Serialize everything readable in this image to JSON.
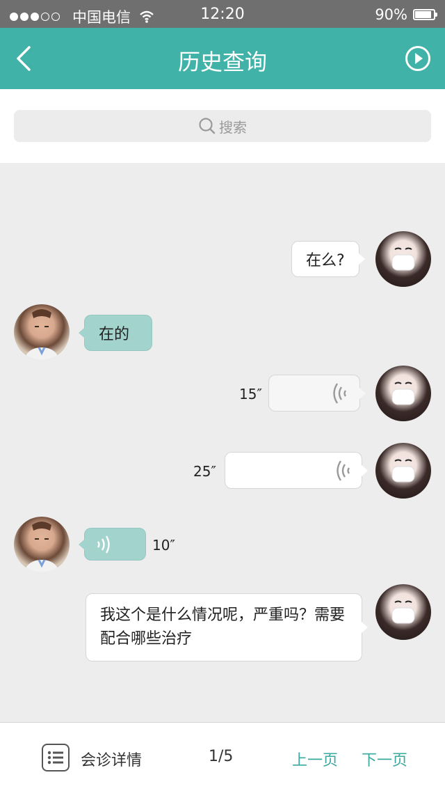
{
  "status_bar": {
    "carrier": "中国电信",
    "time": "12:20",
    "battery": "90%",
    "battery_level": 0.9
  },
  "nav": {
    "title": "历史查询",
    "back_icon": "chevron-left-icon",
    "play_icon": "play-circle-icon"
  },
  "search": {
    "placeholder": "搜索"
  },
  "messages": [
    {
      "sender": "patient",
      "type": "text",
      "text": "在么?"
    },
    {
      "sender": "doctor",
      "type": "text",
      "text": "在的"
    },
    {
      "sender": "patient",
      "type": "voice",
      "duration": "15″"
    },
    {
      "sender": "patient",
      "type": "voice",
      "duration": "25″"
    },
    {
      "sender": "doctor",
      "type": "voice",
      "duration": "10″"
    },
    {
      "sender": "patient",
      "type": "text",
      "text": "我这个是什么情况呢，严重吗？需要配合哪些治疗"
    }
  ],
  "bottom_bar": {
    "detail_label": "会诊详情",
    "page": "1/5",
    "prev_label": "上一页",
    "next_label": "下一页"
  },
  "colors": {
    "accent": "#41b2a8",
    "doctor_bubble": "#a2d3cd",
    "link": "#3aa89d"
  }
}
